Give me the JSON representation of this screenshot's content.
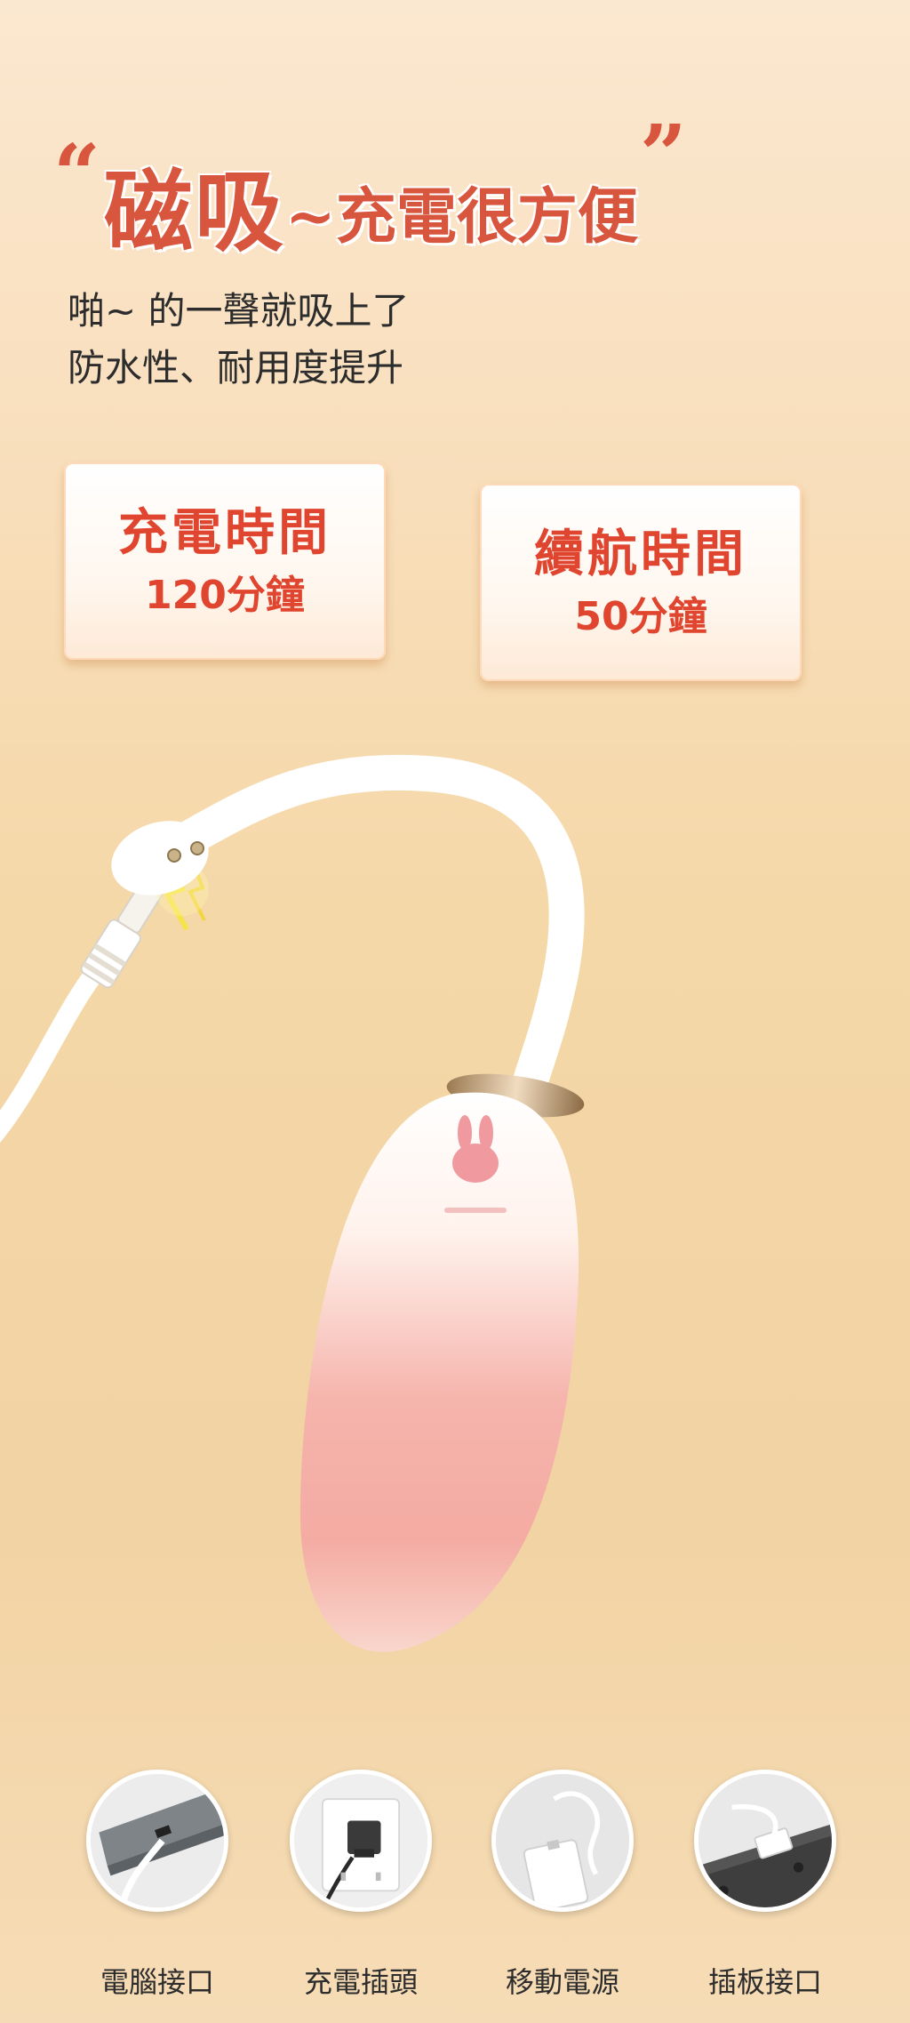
{
  "headline": {
    "open_quote": "“",
    "main": "磁吸",
    "tilde": "~",
    "rest": "充電很方便",
    "close_quote": "”"
  },
  "subtext": {
    "line1": "啪~ 的一聲就吸上了",
    "line2": "防水性、耐用度提升"
  },
  "cards": [
    {
      "title": "充電時間",
      "value": "120分鐘"
    },
    {
      "title": "續航時間",
      "value": "50分鐘"
    }
  ],
  "product": {
    "brand_icon": "rabbit-logo-icon"
  },
  "options": [
    {
      "label": "電腦接口",
      "icon": "laptop-usb-icon"
    },
    {
      "label": "充電插頭",
      "icon": "wall-charger-icon"
    },
    {
      "label": "移動電源",
      "icon": "power-bank-icon"
    },
    {
      "label": "插板接口",
      "icon": "power-strip-icon"
    }
  ],
  "colors": {
    "accent_red": "#d8553e",
    "background_top": "#fbe8d0",
    "background_bottom": "#f2d3a3",
    "device_pink": "#f2a8a0"
  }
}
